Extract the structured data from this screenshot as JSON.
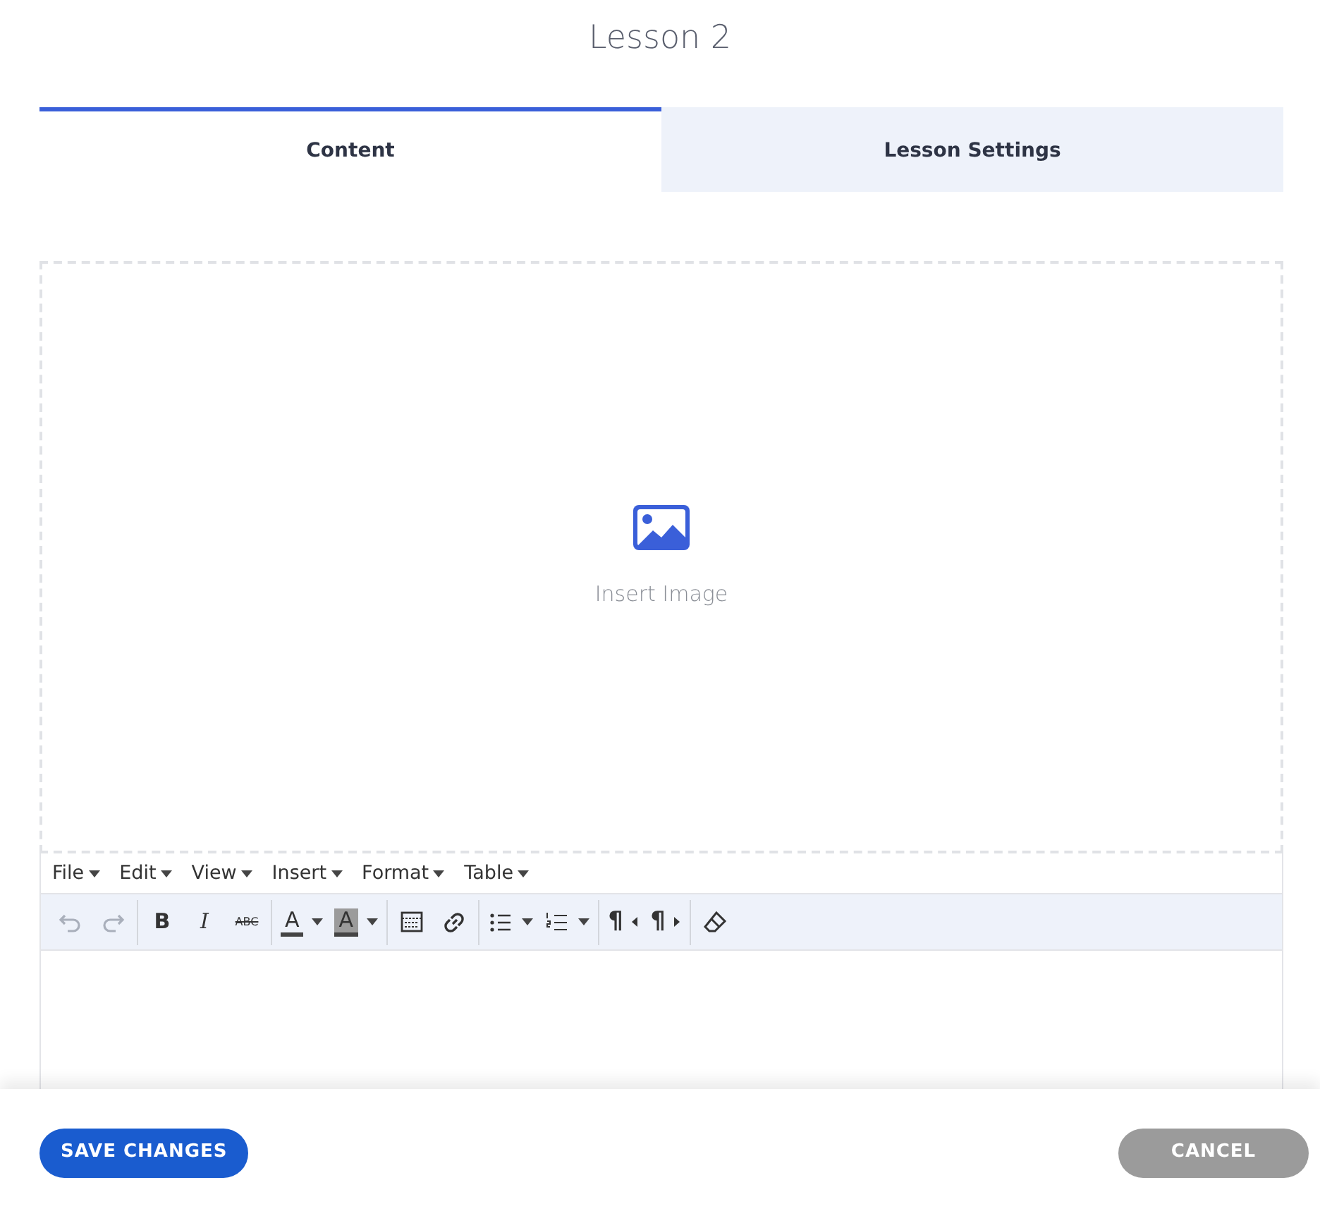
{
  "title": "Lesson 2",
  "tabs": [
    {
      "label": "Content",
      "selected": true
    },
    {
      "label": "Lesson Settings",
      "selected": false
    }
  ],
  "image_drop": {
    "label": "Insert Image"
  },
  "menubar": [
    "File",
    "Edit",
    "View",
    "Insert",
    "Format",
    "Table"
  ],
  "toolbar": [
    [
      {
        "kind": "undo",
        "disabled": true
      },
      {
        "kind": "redo",
        "disabled": true
      }
    ],
    [
      {
        "kind": "bold",
        "label": "B",
        "disabled": false
      },
      {
        "kind": "italic",
        "label": "I",
        "disabled": false
      },
      {
        "kind": "strike",
        "label": "ABC",
        "disabled": false
      }
    ],
    [
      {
        "kind": "forecolor",
        "label": "A",
        "disabled": false
      },
      {
        "kind": "backcolor",
        "label": "A",
        "disabled": false
      }
    ],
    [
      {
        "kind": "table",
        "disabled": false
      },
      {
        "kind": "link",
        "disabled": false
      }
    ],
    [
      {
        "kind": "bullist",
        "disabled": false
      },
      {
        "kind": "numlist",
        "disabled": false
      }
    ],
    [
      {
        "kind": "ltr",
        "label": "¶",
        "disabled": false
      },
      {
        "kind": "rtl",
        "label": "¶",
        "disabled": false
      }
    ],
    [
      {
        "kind": "eraser",
        "disabled": false
      }
    ]
  ],
  "buttons": {
    "save": "SAVE CHANGES",
    "cancel": "CANCEL"
  }
}
